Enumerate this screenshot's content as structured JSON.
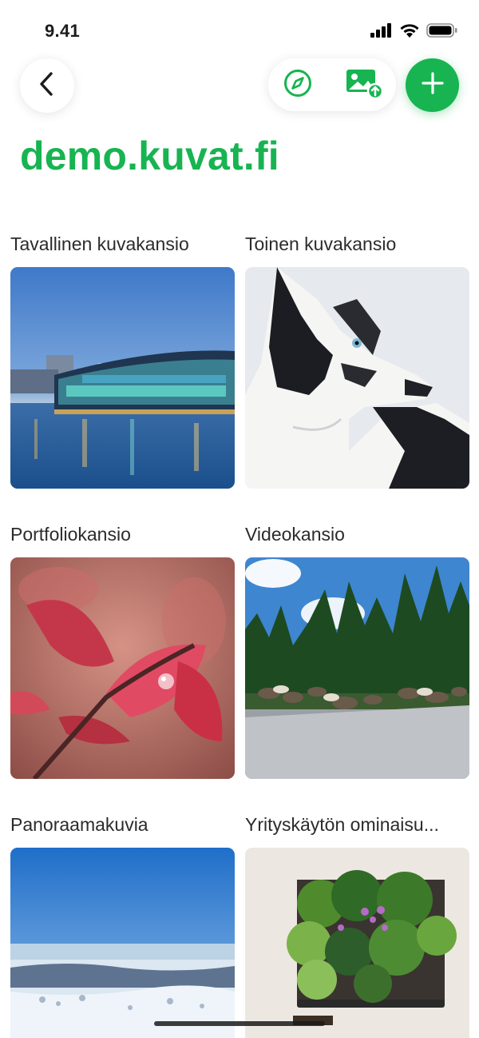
{
  "status_bar": {
    "time": "9.41",
    "icons": [
      "cellular-signal-icon",
      "wifi-icon",
      "battery-icon"
    ]
  },
  "nav": {
    "back_icon": "chevron-left-icon",
    "actions": [
      {
        "name": "explore",
        "icon": "compass-icon"
      },
      {
        "name": "upload",
        "icon": "image-upload-icon"
      },
      {
        "name": "add",
        "icon": "plus-icon"
      }
    ]
  },
  "site_title": "demo.kuvat.fi",
  "colors": {
    "accent": "#17b451"
  },
  "albums": [
    {
      "title": "Tavallinen kuvakansio",
      "image": "city waterfront at dusk"
    },
    {
      "title": "Toinen kuvakansio",
      "image": "border collie dog"
    },
    {
      "title": "Portfoliokansio",
      "image": "red autumn leaves with water drop"
    },
    {
      "title": "Videokansio",
      "image": "reindeer herd on road"
    },
    {
      "title": "Panoraamakuvia",
      "image": "snowy fell landscape"
    },
    {
      "title": "Yrityskäytön ominaisu...",
      "image": "green wall planter"
    }
  ]
}
